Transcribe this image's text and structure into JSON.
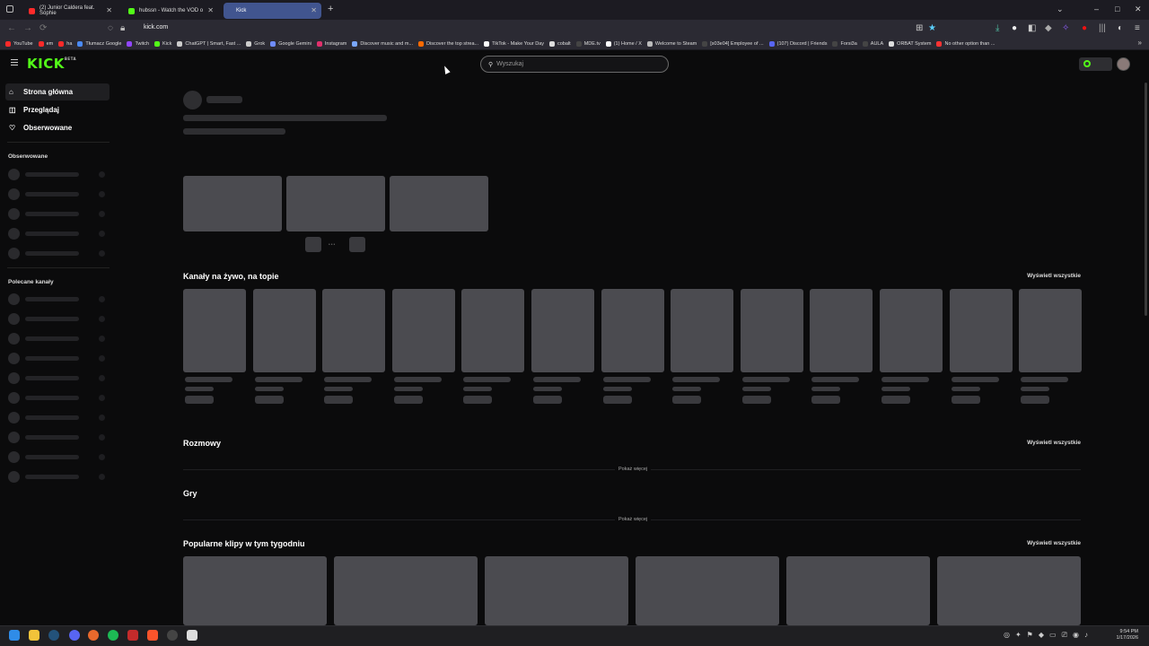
{
  "browser": {
    "tabs": [
      {
        "label": "(2) Junior Caldera feat. Sophie",
        "color": "#ff2a2a"
      },
      {
        "label": "hubssn - Watch the VOD o",
        "color": "#53fc18"
      },
      {
        "label": "Kick",
        "color": "#53fc18",
        "active": true
      }
    ],
    "url": "kick.com",
    "bookmarks": [
      {
        "label": "YouTube",
        "color": "#ff2a2a"
      },
      {
        "label": "em",
        "color": "#ff2a2a"
      },
      {
        "label": "ha",
        "color": "#ff2a2a"
      },
      {
        "label": "Tłumacz Google",
        "color": "#4a8af4"
      },
      {
        "label": "Twitch",
        "color": "#9146ff"
      },
      {
        "label": "Kick",
        "color": "#53fc18"
      },
      {
        "label": "ChatGPT | Smart, Fast ...",
        "color": "#cccccc"
      },
      {
        "label": "Grok",
        "color": "#cccccc"
      },
      {
        "label": "Google Gemini",
        "color": "#6f8cff"
      },
      {
        "label": "Instagram",
        "color": "#e1306c"
      },
      {
        "label": "Discover music and m...",
        "color": "#7aa7ff"
      },
      {
        "label": "Discover the top strea...",
        "color": "#ff6a00"
      },
      {
        "label": "TikTok - Make Your Day",
        "color": "#ffffff"
      },
      {
        "label": "cobalt",
        "color": "#dddddd"
      },
      {
        "label": "MDE.tv",
        "color": "#444444"
      },
      {
        "label": "(1) Home / X",
        "color": "#ffffff"
      },
      {
        "label": "Welcome to Steam",
        "color": "#bbbbbb"
      },
      {
        "label": "[s03e04] Employee of ...",
        "color": "#444444"
      },
      {
        "label": "(107) Discord | Friends",
        "color": "#5865f2"
      },
      {
        "label": "Forsi3a",
        "color": "#444444"
      },
      {
        "label": "AULA",
        "color": "#444444"
      },
      {
        "label": "ORBAT System",
        "color": "#dddddd"
      },
      {
        "label": "No other option than ...",
        "color": "#ff3333"
      }
    ]
  },
  "header": {
    "logo": "KICK",
    "logo_badge": "BETA",
    "search_placeholder": "Wyszukaj"
  },
  "sidebar": {
    "nav": [
      {
        "label": "Strona główna",
        "icon": "home-icon"
      },
      {
        "label": "Przeglądaj",
        "icon": "browse-icon"
      },
      {
        "label": "Obserwowane",
        "icon": "heart-icon"
      }
    ],
    "followed_heading": "Obserwowane",
    "recommended_heading": "Polecane kanały"
  },
  "main": {
    "live_title": "Kanały na żywo, na topie",
    "live_see_all": "Wyświetl wszystkie",
    "talk_title": "Rozmowy",
    "talk_see_all": "Wyświetl wszystkie",
    "talk_more": "Pokaż więcej",
    "games_title": "Gry",
    "games_more": "Pokaż więcej",
    "clips_title": "Popularne klipy w tym tygodniu",
    "clips_see_all": "Wyświetl wszystkie"
  },
  "taskbar": {
    "time": "9:54 PM",
    "date": "1/17/2026"
  },
  "colors": {
    "brand": "#53fc18",
    "background": "#0b0b0c",
    "skeleton": "#4b4b50"
  }
}
